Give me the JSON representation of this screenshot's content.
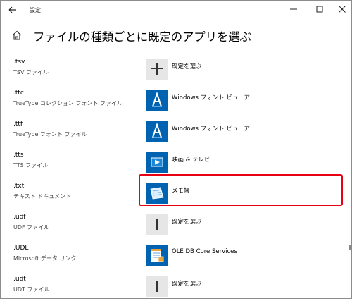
{
  "window": {
    "title": "設定"
  },
  "header": {
    "title": "ファイルの種類ごとに既定のアプリを選ぶ"
  },
  "rows": [
    {
      "ext": ".tsv",
      "desc": "TSV ファイル",
      "app": "既定を選ぶ",
      "icon": "plus-icon"
    },
    {
      "ext": ".ttc",
      "desc": "TrueType コレクション フォント ファイル",
      "app": "Windows フォント ビューアー",
      "icon": "font-viewer-icon"
    },
    {
      "ext": ".ttf",
      "desc": "TrueType フォント ファイル",
      "app": "Windows フォント ビューアー",
      "icon": "font-viewer-icon"
    },
    {
      "ext": ".tts",
      "desc": "TTS ファイル",
      "app": "映画 & テレビ",
      "icon": "movies-tv-icon"
    },
    {
      "ext": ".txt",
      "desc": "テキスト ドキュメント",
      "app": "メモ帳",
      "icon": "notepad-icon"
    },
    {
      "ext": ".udf",
      "desc": "UDF ファイル",
      "app": "既定を選ぶ",
      "icon": "plus-icon"
    },
    {
      "ext": ".UDL",
      "desc": "Microsoft データ リンク",
      "app": "OLE DB Core Services",
      "icon": "ole-db-icon"
    },
    {
      "ext": ".udt",
      "desc": "UDT ファイル",
      "app": "既定を選ぶ",
      "icon": "plus-icon"
    }
  ],
  "colors": {
    "highlight": "#e60012",
    "tile_blue": "#0063b1",
    "tile_gray": "#e6e6e6"
  }
}
